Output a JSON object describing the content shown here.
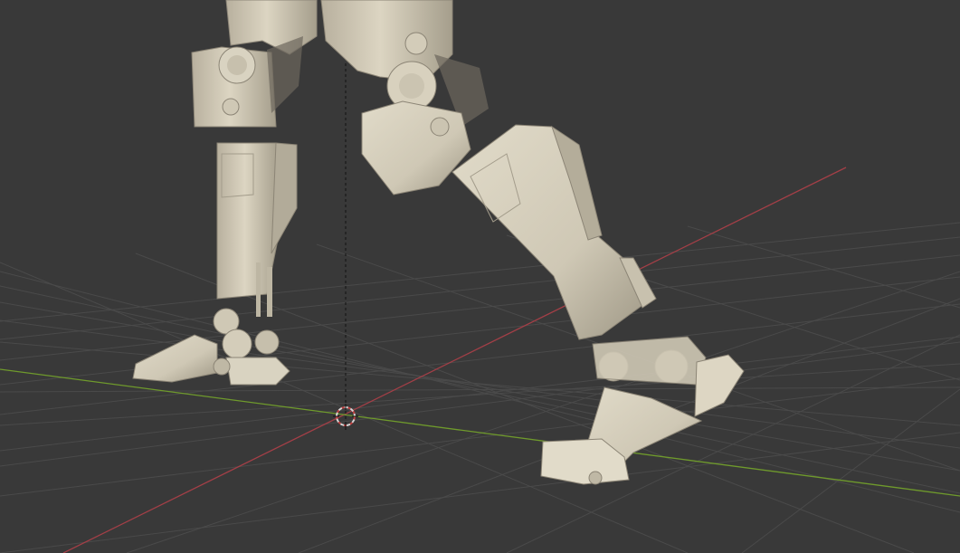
{
  "viewport": {
    "background_color": "#393939",
    "grid_line_color": "#4a4a4a",
    "x_axis_color": "#a33f47",
    "y_axis_color": "#6f9a2c",
    "cursor_color": "#d6d6d6",
    "cursor_ring_color": "#c04141",
    "model_color": "#d7d0bd",
    "model_shade_color": "#a8a190",
    "model_dark_color": "#6c675d"
  },
  "scene": {
    "object": "robot-legs",
    "icons": {
      "cursor": "3d-cursor-icon",
      "origin": "object-origin-line"
    }
  }
}
